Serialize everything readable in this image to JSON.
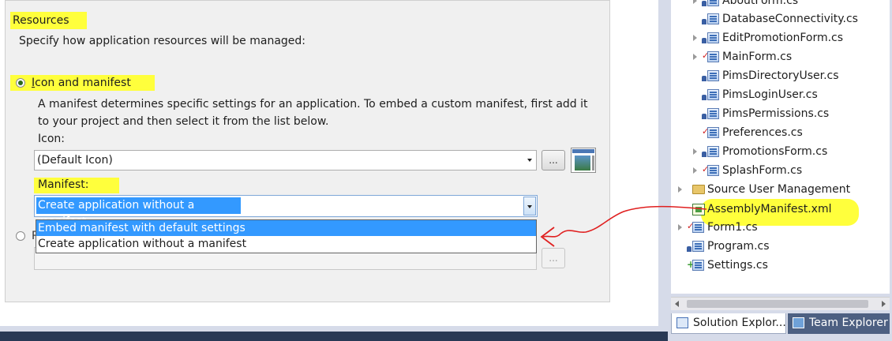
{
  "resources": {
    "title": "Resources",
    "description": "Specify how application resources will be managed:",
    "icon_manifest_radio_label": "Icon and manifest",
    "icon_manifest_radio_access_key": "I",
    "icon_manifest_radio_rest": "con and manifest",
    "manifest_description": "A manifest determines specific settings for an application. To embed a custom manifest, first add it to your project and then select it from the list below.",
    "icon_label": "Icon:",
    "icon_value": "(Default Icon)",
    "browse_label": "...",
    "manifest_label": "Manifest:",
    "manifest_value": "Create application without a manifest",
    "manifest_options": [
      "Embed manifest with default settings",
      "Create application without a manifest"
    ],
    "second_radio_label": "R",
    "disabled_browse_label": "..."
  },
  "solution_explorer": {
    "items": [
      {
        "label": "AboutForm.cs",
        "icon": "form-icon",
        "status": "lock",
        "expandable": true
      },
      {
        "label": "DatabaseConnectivity.cs",
        "icon": "cs-file-icon",
        "status": "lock",
        "expandable": false
      },
      {
        "label": "EditPromotionForm.cs",
        "icon": "form-icon",
        "status": "lock",
        "expandable": true
      },
      {
        "label": "MainForm.cs",
        "icon": "form-icon",
        "status": "check",
        "expandable": true
      },
      {
        "label": "PimsDirectoryUser.cs",
        "icon": "cs-file-icon",
        "status": "lock",
        "expandable": false
      },
      {
        "label": "PimsLoginUser.cs",
        "icon": "cs-file-icon",
        "status": "lock",
        "expandable": false
      },
      {
        "label": "PimsPermissions.cs",
        "icon": "cs-file-icon",
        "status": "lock",
        "expandable": false
      },
      {
        "label": "Preferences.cs",
        "icon": "cs-file-icon",
        "status": "check",
        "expandable": false
      },
      {
        "label": "PromotionsForm.cs",
        "icon": "form-icon",
        "status": "lock",
        "expandable": true
      },
      {
        "label": "SplashForm.cs",
        "icon": "form-icon",
        "status": "check",
        "expandable": true
      },
      {
        "label": "Source User Management",
        "icon": "folder-icon",
        "status": "",
        "expandable": true
      },
      {
        "label": "AssemblyManifest.xml",
        "icon": "xml-file-icon",
        "status": "",
        "expandable": false
      },
      {
        "label": "Form1.cs",
        "icon": "form-icon",
        "status": "check",
        "expandable": true
      },
      {
        "label": "Program.cs",
        "icon": "cs-file-icon",
        "status": "lock",
        "expandable": false
      },
      {
        "label": "Settings.cs",
        "icon": "cs-file-icon",
        "status": "plus",
        "expandable": false
      }
    ],
    "tabs": [
      {
        "label": "Solution Explor...",
        "active": true
      },
      {
        "label": "Team Explorer",
        "active": false
      }
    ]
  },
  "colors": {
    "highlight": "#ffff3c",
    "selection": "#3399ff",
    "annotation_arrow": "#e02020",
    "ide_frame": "#293955"
  }
}
